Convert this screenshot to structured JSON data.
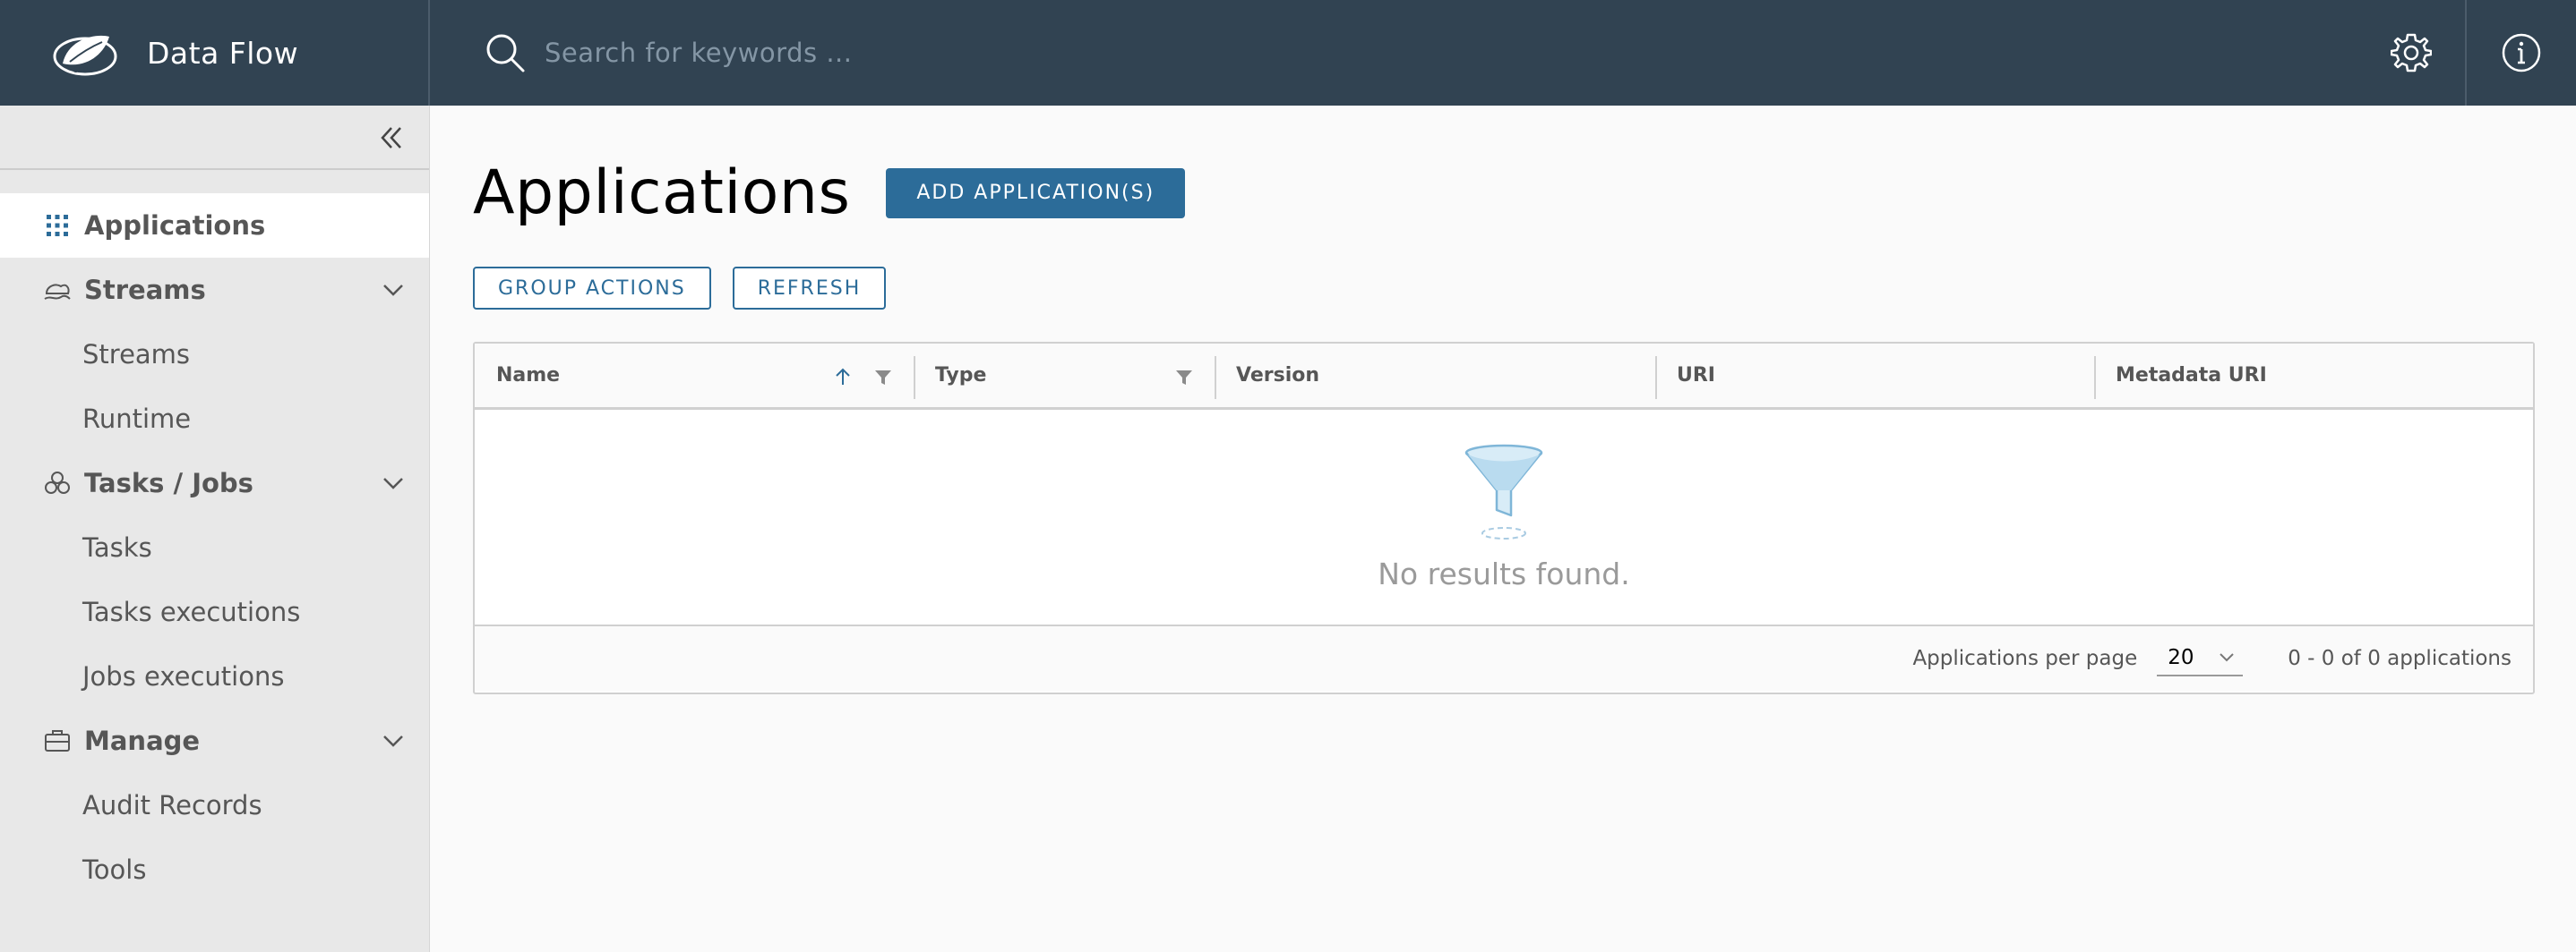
{
  "header": {
    "app_title": "Data Flow",
    "search_placeholder": "Search for keywords ...",
    "icons": [
      "spring-logo-icon",
      "search-icon",
      "gear-icon",
      "info-icon"
    ]
  },
  "sidebar": {
    "collapse_icon": "double-chevron-left-icon",
    "items": [
      {
        "label": "Applications",
        "icon": "grid-icon",
        "active": true
      },
      {
        "label": "Streams",
        "icon": "streams-icon",
        "expandable": true,
        "children": [
          "Streams",
          "Runtime"
        ]
      },
      {
        "label": "Tasks / Jobs",
        "icon": "tasks-icon",
        "expandable": true,
        "children": [
          "Tasks",
          "Tasks executions",
          "Jobs executions"
        ]
      },
      {
        "label": "Manage",
        "icon": "briefcase-icon",
        "expandable": true,
        "children": [
          "Audit Records",
          "Tools"
        ]
      }
    ]
  },
  "main": {
    "title": "Applications",
    "add_button": "ADD APPLICATION(S)",
    "group_actions_button": "GROUP ACTIONS",
    "refresh_button": "REFRESH",
    "table": {
      "columns": [
        "Name",
        "Type",
        "Version",
        "URI",
        "Metadata URI"
      ],
      "rows": [],
      "empty_message": "No results found.",
      "footer": {
        "per_page_label": "Applications per page",
        "page_size": "20",
        "pagination_text": "0 - 0 of 0 applications"
      }
    }
  },
  "colors": {
    "header_bg": "#314352",
    "sidebar_bg": "#e8e8e8",
    "primary": "#2c6c99",
    "content_bg": "#fafafa"
  }
}
